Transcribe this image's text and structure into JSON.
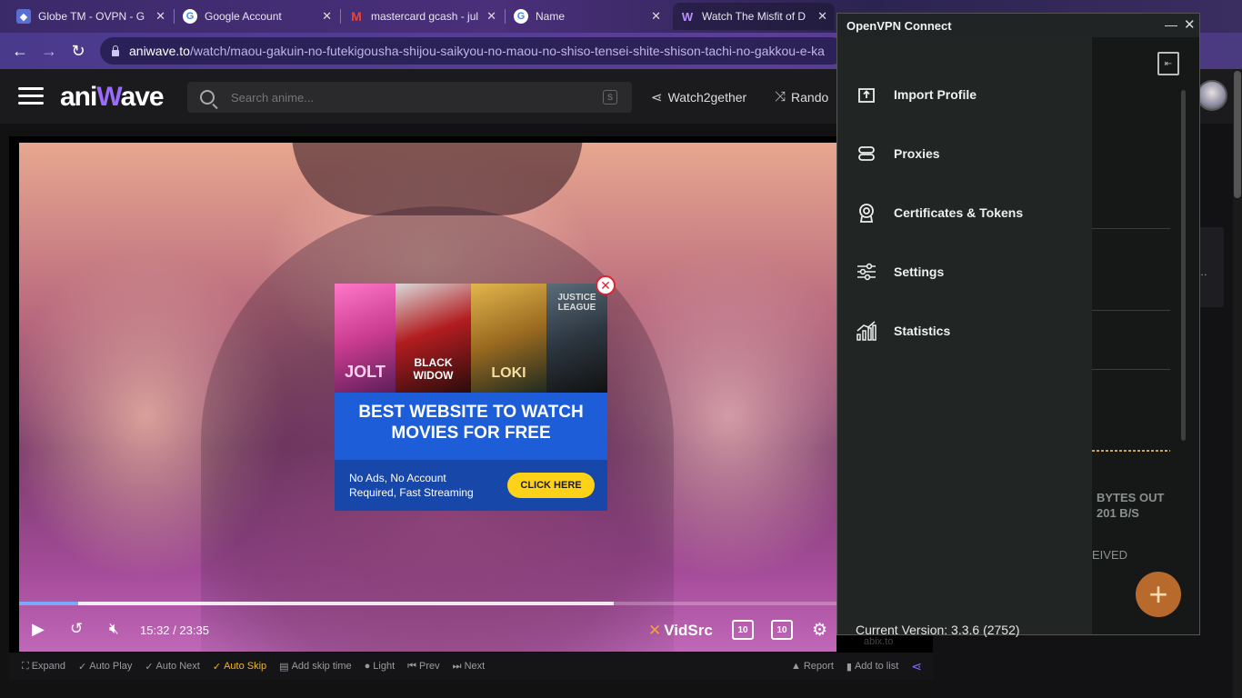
{
  "browser": {
    "tabs": [
      {
        "label": "Globe TM - OVPN - G",
        "icon": "shield-favicon"
      },
      {
        "label": "Google Account",
        "icon": "google-favicon"
      },
      {
        "label": "mastercard gcash - jul",
        "icon": "gmail-favicon"
      },
      {
        "label": "Name",
        "icon": "google-favicon"
      },
      {
        "label": "Watch The Misfit of D",
        "icon": "aniwave-favicon"
      }
    ],
    "url_domain": "aniwave.to",
    "url_path": "/watch/maou-gakuin-no-futekigousha-shijou-saikyou-no-maou-no-shiso-tensei-shite-shison-tachi-no-gakkou-e-ka"
  },
  "site": {
    "logo_left": "ani",
    "logo_w": "W",
    "logo_right": "ave",
    "search_placeholder": "Search anime...",
    "search_key": "S",
    "watch2gether": "Watch2gether",
    "random": "Rando"
  },
  "player": {
    "current_time": "15:32",
    "separator": "/",
    "duration": "23:35",
    "progress_fraction": 0.0728,
    "buffered_fraction": 0.728,
    "source_brand": "VidSrc",
    "skip_back": "10",
    "skip_fwd": "10",
    "watermark": "abix.to"
  },
  "bottom_bar": {
    "expand": "Expand",
    "auto_play": "Auto Play",
    "auto_next": "Auto Next",
    "auto_skip": "Auto Skip",
    "add_skip_time": "Add skip time",
    "light": "Light",
    "prev": "Prev",
    "next": "Next",
    "report": "Report",
    "add_to_list": "Add to list"
  },
  "ad": {
    "poster1": "JOLT",
    "poster2": "BLACK WIDOW",
    "poster3": "LOKI",
    "poster4": "JUSTICE LEAGUE",
    "headline_line1": "BEST WEBSITE TO WATCH",
    "headline_line2": "MOVIES FOR FREE",
    "sub_line1": "No Ads, No Account",
    "sub_line2": "Required, Fast Streaming",
    "cta": "CLICK HERE"
  },
  "vpn": {
    "title": "OpenVPN Connect",
    "menu": [
      {
        "label": "Import Profile",
        "icon": "import-icon"
      },
      {
        "label": "Proxies",
        "icon": "proxies-icon"
      },
      {
        "label": "Certificates & Tokens",
        "icon": "certificate-icon"
      },
      {
        "label": "Settings",
        "icon": "settings-sliders-icon"
      },
      {
        "label": "Statistics",
        "icon": "statistics-icon"
      }
    ],
    "version": "Current Version: 3.3.6 (2752)",
    "bytes_out_label": "BYTES OUT",
    "bytes_out_value": "201 B/S",
    "received_fragment": "EIVED",
    "accent": "#b86a2c"
  }
}
